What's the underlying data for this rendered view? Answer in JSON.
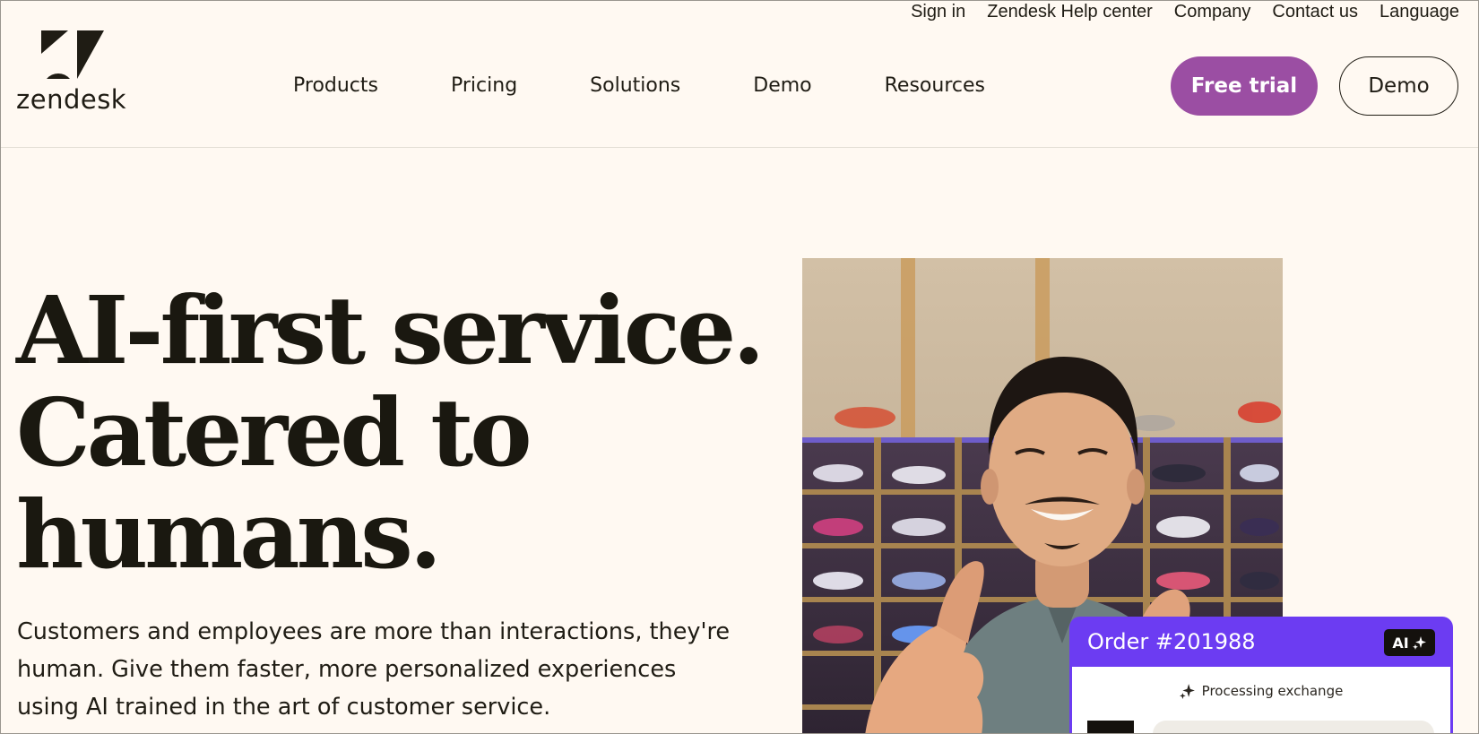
{
  "utility_nav": {
    "sign_in": "Sign in",
    "help_center": "Zendesk Help center",
    "company": "Company",
    "contact": "Contact us",
    "language": "Language"
  },
  "logo": {
    "wordmark": "zendesk"
  },
  "main_nav": {
    "products": "Products",
    "pricing": "Pricing",
    "solutions": "Solutions",
    "demo": "Demo",
    "resources": "Resources"
  },
  "header_buttons": {
    "free_trial": "Free trial",
    "demo": "Demo"
  },
  "hero": {
    "title_line1": "AI-first service.",
    "title_line2": "Catered to",
    "title_line3": "humans.",
    "subtitle": "Customers and employees are more than interactions, they're human. Give them faster, more personalized experiences using AI trained in the art of customer service."
  },
  "order_card": {
    "title": "Order #201988",
    "badge": "AI",
    "status": "Processing exchange"
  },
  "colors": {
    "background": "#fff9f2",
    "accent_purple": "#9b4ea3",
    "card_violet": "#6c3cf2",
    "text_dark": "#1f1c14"
  },
  "icons": {
    "logo_mark": "zendesk-logo-icon",
    "sparkle": "sparkle-icon"
  }
}
